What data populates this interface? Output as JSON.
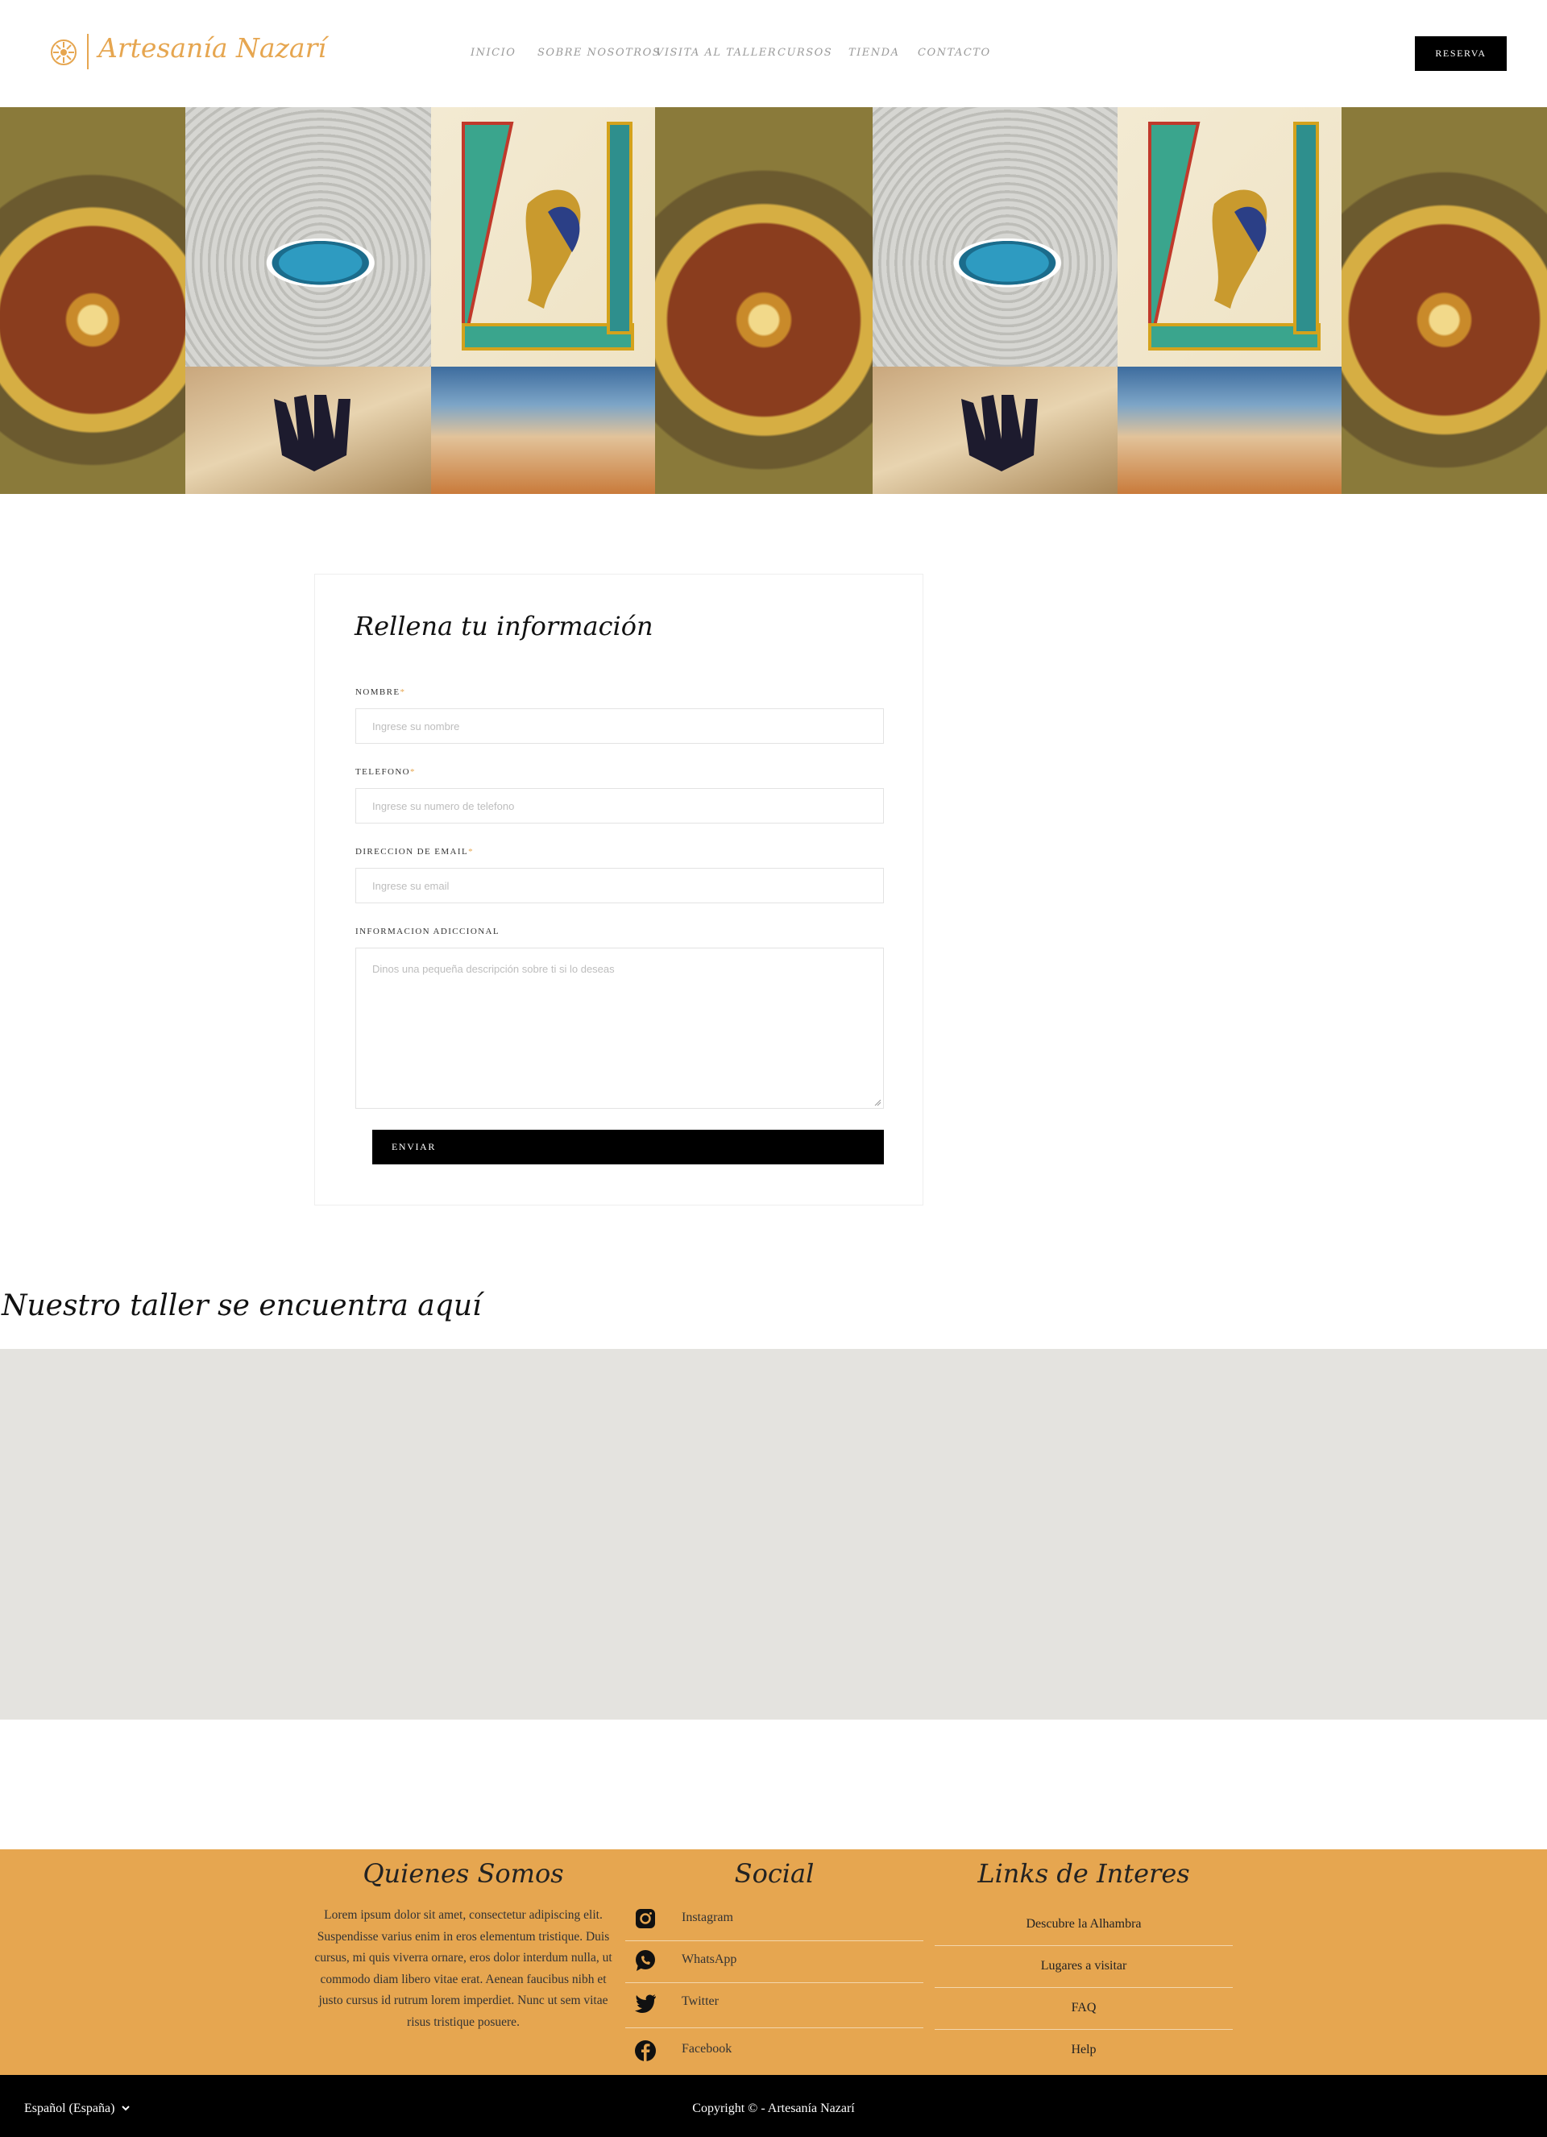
{
  "header": {
    "logo_text": "Artesanía Nazarí",
    "nav": [
      "INICIO",
      "SOBRE NOSOTROS",
      "VISITA AL TALLER",
      "CURSOS",
      "TIENDA",
      "CONTACTO"
    ],
    "cta_label": "RESERVA"
  },
  "form": {
    "title": "Rellena tu información",
    "fields": [
      {
        "label": "NOMBRE",
        "required_mark": "*",
        "placeholder": "Ingrese su nombre"
      },
      {
        "label": "TELEFONO",
        "required_mark": "*",
        "placeholder": "Ingrese su numero de telefono"
      },
      {
        "label": "DIRECCION DE EMAIL",
        "required_mark": "*",
        "placeholder": "Ingrese su email"
      }
    ],
    "extra_label": "INFORMACION ADICCIONAL",
    "extra_placeholder": "Dinos una pequeña descripción sobre ti si lo deseas",
    "submit_label": "ENVIAR"
  },
  "map_section": {
    "title": "Nuestro taller se encuentra aquí"
  },
  "footer": {
    "about": {
      "heading": "Quienes Somos",
      "text": "Lorem ipsum dolor sit amet, consectetur adipiscing elit. Suspendisse varius enim in eros elementum tristique. Duis cursus, mi quis viverra ornare, eros dolor interdum nulla, ut commodo diam libero vitae erat. Aenean faucibus nibh et justo cursus id rutrum lorem imperdiet. Nunc ut sem vitae risus tristique posuere."
    },
    "social": {
      "heading": "Social",
      "items": [
        {
          "label": "Instagram",
          "icon": "instagram-icon"
        },
        {
          "label": "WhatsApp",
          "icon": "whatsapp-icon"
        },
        {
          "label": "Twitter",
          "icon": "twitter-icon"
        },
        {
          "label": "Facebook",
          "icon": "facebook-icon"
        }
      ]
    },
    "links": {
      "heading": "Links de Interes",
      "items": [
        "Descubre la Alhambra",
        "Lugares a visitar",
        "FAQ",
        "Help"
      ]
    }
  },
  "bottom_bar": {
    "language": "Español (España)",
    "copyright": "Copyright © - Artesanía Nazarí"
  },
  "colors": {
    "brand": "#e6a650",
    "dark": "#000000",
    "map_bg": "#e4e3df"
  }
}
